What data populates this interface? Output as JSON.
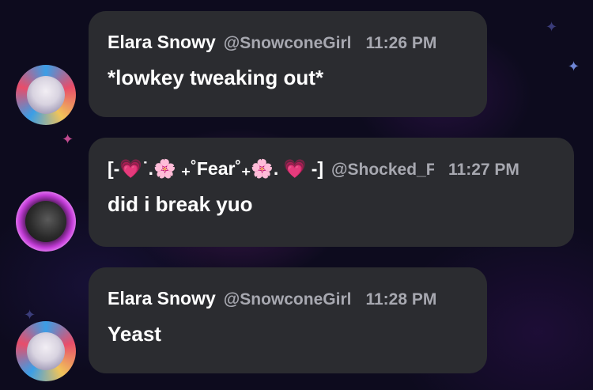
{
  "messages": [
    {
      "author": "Elara Snowy",
      "handle": "@SnowconeGirl",
      "time": "11:26 PM",
      "text": "*lowkey tweaking out*",
      "avatar_icon": "anime-girl-avatar"
    },
    {
      "author_parts": {
        "open": "[-",
        "heart": "💗",
        "dots": "˙.",
        "flower": "🌸",
        "pre": " ₊˚Fear˚₊",
        "flower2": "🌸",
        "dot2": ". ",
        "heart2": "💗",
        "close": " -]"
      },
      "handle": "@Shocked_F",
      "time": "11:27 PM",
      "text": "did i break yuo",
      "avatar_icon": "shadow-figure-avatar"
    },
    {
      "author": "Elara Snowy",
      "handle": "@SnowconeGirl",
      "time": "11:28 PM",
      "text": "Yeast",
      "avatar_icon": "anime-girl-avatar"
    }
  ],
  "colors": {
    "bubble": "#2b2c30",
    "name": "#ffffff",
    "meta": "#a7a8b0",
    "background": "#0d0b1e"
  }
}
